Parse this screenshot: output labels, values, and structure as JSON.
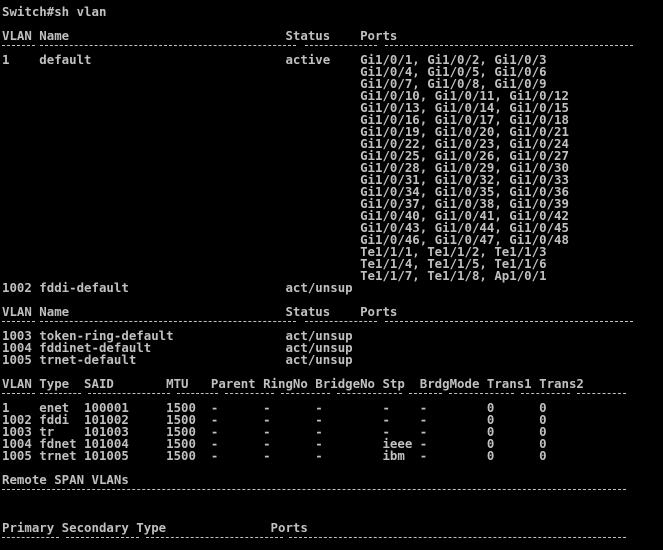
{
  "colors": {
    "background": "#000000",
    "foreground": "#c0c0c0"
  },
  "prompt": "Switch#sh vlan",
  "section1": {
    "header": "VLAN Name                             Status    Ports",
    "rows": [
      "1    default                          active    Gi1/0/1, Gi1/0/2, Gi1/0/3",
      "                                                Gi1/0/4, Gi1/0/5, Gi1/0/6",
      "                                                Gi1/0/7, Gi1/0/8, Gi1/0/9",
      "                                                Gi1/0/10, Gi1/0/11, Gi1/0/12",
      "                                                Gi1/0/13, Gi1/0/14, Gi1/0/15",
      "                                                Gi1/0/16, Gi1/0/17, Gi1/0/18",
      "                                                Gi1/0/19, Gi1/0/20, Gi1/0/21",
      "                                                Gi1/0/22, Gi1/0/23, Gi1/0/24",
      "                                                Gi1/0/25, Gi1/0/26, Gi1/0/27",
      "                                                Gi1/0/28, Gi1/0/29, Gi1/0/30",
      "                                                Gi1/0/31, Gi1/0/32, Gi1/0/33",
      "                                                Gi1/0/34, Gi1/0/35, Gi1/0/36",
      "                                                Gi1/0/37, Gi1/0/38, Gi1/0/39",
      "                                                Gi1/0/40, Gi1/0/41, Gi1/0/42",
      "                                                Gi1/0/43, Gi1/0/44, Gi1/0/45",
      "                                                Gi1/0/46, Gi1/0/47, Gi1/0/48",
      "                                                Te1/1/1, Te1/1/2, Te1/1/3",
      "                                                Te1/1/4, Te1/1/5, Te1/1/6",
      "                                                Te1/1/7, Te1/1/8, Ap1/0/1",
      "1002 fddi-default                     act/unsup"
    ]
  },
  "section2": {
    "header": "VLAN Name                             Status    Ports",
    "rows": [
      "1003 token-ring-default               act/unsup",
      "1004 fddinet-default                  act/unsup",
      "1005 trnet-default                    act/unsup"
    ]
  },
  "section3": {
    "header": "VLAN Type  SAID       MTU   Parent RingNo BridgeNo Stp  BrdgMode Trans1 Trans2",
    "rows": [
      "1    enet  100001     1500  -      -      -        -    -        0      0",
      "1002 fddi  101002     1500  -      -      -        -    -        0      0",
      "1003 tr    101003     1500  -      -      -        -    -        0      0",
      "1004 fdnet 101004     1500  -      -      -        ieee -        0      0",
      "1005 trnet 101005     1500  -      -      -        ibm  -        0      0"
    ]
  },
  "remote_span": "Remote SPAN VLANs",
  "private_vlan_header": "Primary Secondary Type              Ports"
}
